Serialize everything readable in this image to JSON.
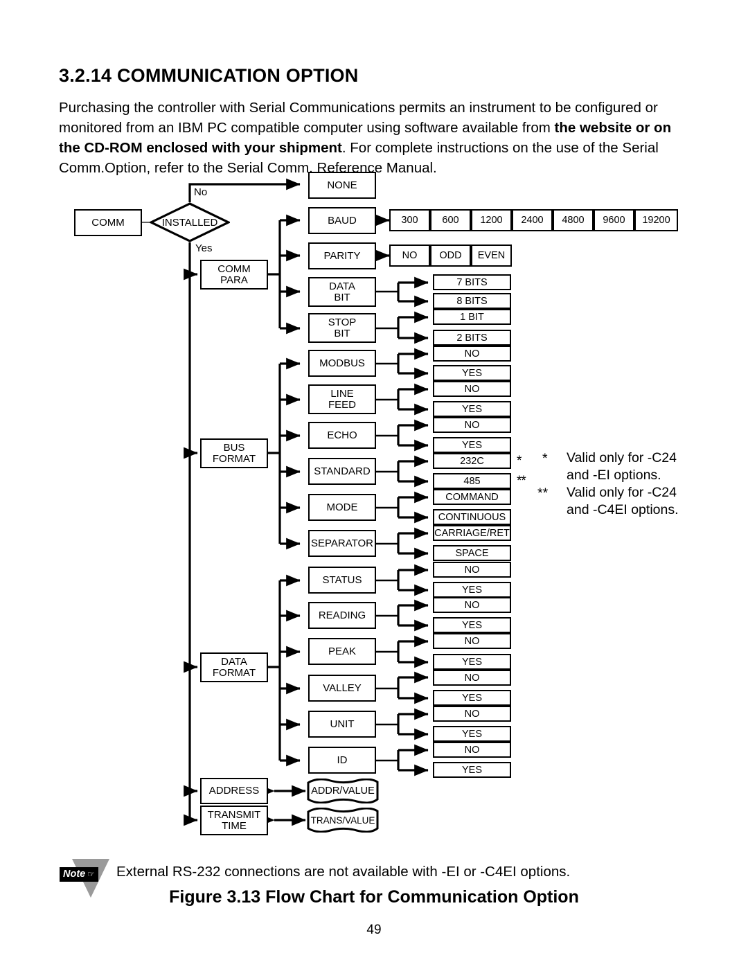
{
  "section": {
    "number": "3.2.14",
    "heading": "3.2.14 COMMUNICATION OPTION",
    "paragraph_plain": "Purchasing the controller with Serial Communications permits an instrument to be configured or monitored from an IBM PC compatible computer using software  available from the website or on the CD-ROM enclosed with your shipment. For complete instructions on the use of the Serial Comm.Option, refer to the Serial Comm. Reference Manual.",
    "paragraph_part1": "Purchasing the controller with Serial Communications permits an instrument to be configured or monitored from an IBM PC compatible computer using software  available from ",
    "paragraph_bold": "the website or on the CD-ROM enclosed with your shipment",
    "paragraph_part2": ". For complete instructions on the use of the Serial Comm.Option, refer to the Serial Comm. Reference Manual."
  },
  "note": {
    "badge_label": "Note",
    "badge_icon": "pointing-hand-icon",
    "text": "External RS-232 connections are not available with -EI or -C4EI options."
  },
  "caption": "Figure 3.13 Flow Chart for Communication Option",
  "page_number": "49",
  "footnotes": [
    {
      "mark": "*",
      "line1": "Valid only for -C24",
      "line2": "and -EI options."
    },
    {
      "mark": "**",
      "line1": "Valid only for -C24",
      "line2": "and -C4EI options."
    }
  ],
  "chart_data": {
    "type": "diagram",
    "title": "Figure 3.13 Flow Chart for Communication Option",
    "root": "COMM",
    "decision": {
      "label": "INSTALLED",
      "no_label": "No",
      "yes_label": "Yes"
    },
    "no_branch": "NONE",
    "groups": [
      {
        "name": "COMM PARA",
        "items": [
          {
            "name": "BAUD",
            "values": [
              "300",
              "600",
              "1200",
              "2400",
              "4800",
              "9600",
              "19200"
            ],
            "layout": "row"
          },
          {
            "name": "PARITY",
            "values": [
              "NO",
              "ODD",
              "EVEN"
            ],
            "layout": "row"
          },
          {
            "name": "DATA BIT",
            "values": [
              "7 BITS",
              "8 BITS"
            ],
            "layout": "fork"
          },
          {
            "name": "STOP BIT",
            "values": [
              "1 BIT",
              "2 BITS"
            ],
            "layout": "fork"
          }
        ]
      },
      {
        "name": "BUS FORMAT",
        "items": [
          {
            "name": "MODBUS",
            "values": [
              "NO",
              "YES"
            ],
            "layout": "fork"
          },
          {
            "name": "LINE FEED",
            "values": [
              "NO",
              "YES"
            ],
            "layout": "fork"
          },
          {
            "name": "ECHO",
            "values": [
              "NO",
              "YES"
            ],
            "layout": "fork"
          },
          {
            "name": "STANDARD",
            "values": [
              "232C",
              "485"
            ],
            "marks": [
              "*",
              "**"
            ],
            "layout": "fork"
          },
          {
            "name": "MODE",
            "values": [
              "COMMAND",
              "CONTINUOUS"
            ],
            "layout": "fork"
          },
          {
            "name": "SEPARATOR",
            "values": [
              "CARRIAGE/RET",
              "SPACE"
            ],
            "layout": "fork"
          }
        ]
      },
      {
        "name": "DATA FORMAT",
        "items": [
          {
            "name": "STATUS",
            "values": [
              "NO",
              "YES"
            ],
            "layout": "fork"
          },
          {
            "name": "READING",
            "values": [
              "NO",
              "YES"
            ],
            "layout": "fork"
          },
          {
            "name": "PEAK",
            "values": [
              "NO",
              "YES"
            ],
            "layout": "fork"
          },
          {
            "name": "VALLEY",
            "values": [
              "NO",
              "YES"
            ],
            "layout": "fork"
          },
          {
            "name": "UNIT",
            "values": [
              "NO",
              "YES"
            ],
            "layout": "fork"
          },
          {
            "name": "ID",
            "values": [
              "NO",
              "YES"
            ],
            "layout": "fork"
          }
        ]
      },
      {
        "name": "ADDRESS",
        "tape": "ADDR/VALUE",
        "layout": "tape"
      },
      {
        "name": "TRANSMIT TIME",
        "tape": "TRANS/VALUE",
        "layout": "tape"
      }
    ]
  },
  "nodes": {
    "comm": "COMM",
    "installed": "INSTALLED",
    "no": "No",
    "yes": "Yes",
    "none": "NONE",
    "comm_para_l1": "COMM",
    "comm_para_l2": "PARA",
    "bus_format_l1": "BUS",
    "bus_format_l2": "FORMAT",
    "data_format_l1": "DATA",
    "data_format_l2": "FORMAT",
    "address": "ADDRESS",
    "transmit_l1": "TRANSMIT",
    "transmit_l2": "TIME",
    "baud": "BAUD",
    "parity": "PARITY",
    "data_bit_l1": "DATA",
    "data_bit_l2": "BIT",
    "stop_bit_l1": "STOP",
    "stop_bit_l2": "BIT",
    "modbus": "MODBUS",
    "line_feed_l1": "LINE",
    "line_feed_l2": "FEED",
    "echo": "ECHO",
    "standard": "STANDARD",
    "mode": "MODE",
    "separator": "SEPARATOR",
    "status": "STATUS",
    "reading": "READING",
    "peak": "PEAK",
    "valley": "VALLEY",
    "unit": "UNIT",
    "id": "ID",
    "addr_value": "ADDR/VALUE",
    "trans_value": "TRANS/VALUE"
  },
  "baud_values": [
    "300",
    "600",
    "1200",
    "2400",
    "4800",
    "9600",
    "19200"
  ],
  "parity_values": [
    "NO",
    "ODD",
    "EVEN"
  ],
  "terminals": {
    "data_bit": [
      "7 BITS",
      "8 BITS"
    ],
    "stop_bit": [
      "1 BIT",
      "2 BITS"
    ],
    "modbus": [
      "NO",
      "YES"
    ],
    "line_feed": [
      "NO",
      "YES"
    ],
    "echo": [
      "NO",
      "YES"
    ],
    "standard": [
      "232C",
      "485"
    ],
    "mode": [
      "COMMAND",
      "CONTINUOUS"
    ],
    "separator": [
      "CARRIAGE/RET",
      "SPACE"
    ],
    "status": [
      "NO",
      "YES"
    ],
    "reading": [
      "NO",
      "YES"
    ],
    "peak": [
      "NO",
      "YES"
    ],
    "valley": [
      "NO",
      "YES"
    ],
    "unit": [
      "NO",
      "YES"
    ],
    "id": [
      "NO",
      "YES"
    ]
  }
}
